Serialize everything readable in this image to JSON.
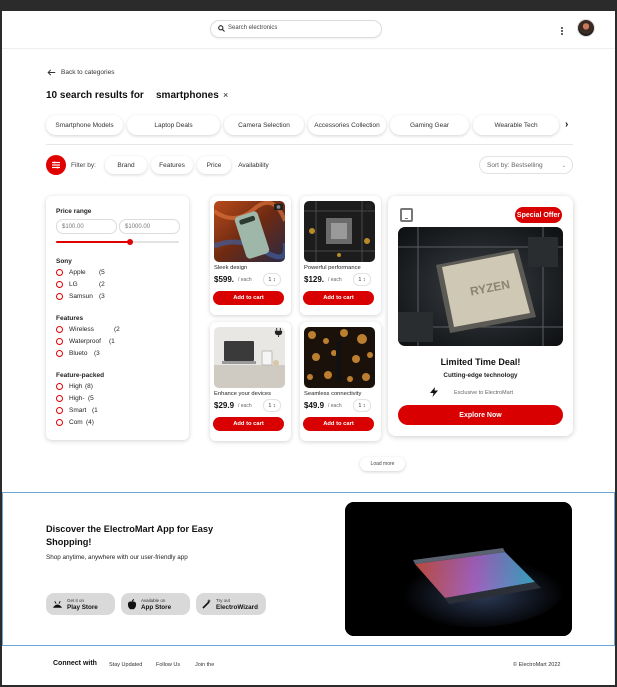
{
  "header": {
    "search_placeholder": "Search electronics",
    "avatar_icon": "user-avatar",
    "menu_icon": "kebab-menu-icon"
  },
  "nav": {
    "back_label": "Back to categories"
  },
  "results": {
    "heading": "10 search results for",
    "query": "smartphones",
    "clear_icon": "×"
  },
  "categories": [
    "Smartphone Models",
    "Laptop Deals",
    "Camera Selection",
    "Accessories Collection",
    "Gaming Gear",
    "Wearable Tech"
  ],
  "categories_next": "›",
  "filters": {
    "label": "Filter by:",
    "chips": [
      "Brand",
      "Features",
      "Price",
      "Availability"
    ],
    "sort": "Sort by: Bestselling",
    "sort_caret": "⌄"
  },
  "sidebar": {
    "price_range": {
      "title": "Price range",
      "min_placeholder": "$100.00",
      "max_placeholder": "$1000.00",
      "slider_level": 0.6
    },
    "groups": [
      {
        "title": "Sony",
        "options": [
          {
            "label": "Apple",
            "count": "(5"
          },
          {
            "label": "LG",
            "count": "(2"
          },
          {
            "label": "Samsun",
            "count": "(3"
          }
        ]
      },
      {
        "title": "Features",
        "options": [
          {
            "label": "Wireless",
            "count": "(2"
          },
          {
            "label": "Waterproof",
            "count": "(1"
          },
          {
            "label": "Blueto",
            "count": "(3"
          }
        ]
      },
      {
        "title": "Feature-packed",
        "options": [
          {
            "label": "High",
            "count": "(8)"
          },
          {
            "label": "High-",
            "count": "(5"
          },
          {
            "label": "Smart",
            "count": "(1"
          },
          {
            "label": "Com",
            "count": "(4)"
          }
        ]
      }
    ]
  },
  "products": [
    {
      "title": "Sleek design",
      "price": "$599.",
      "unit": "/ each",
      "qty": "1 ↕",
      "cta": "Add to cart"
    },
    {
      "title": "Powerful performance",
      "price": "$129.",
      "unit": "/ each",
      "qty": "1 ↕",
      "cta": "Add to cart"
    },
    {
      "title": "Enhance your devices",
      "price": "$29.9",
      "unit": "/ each",
      "qty": "1 ↕",
      "cta": "Add to cart"
    },
    {
      "title": "Seamless connectivity",
      "price": "$49.9",
      "unit": "/ each",
      "qty": "1 ↕",
      "cta": "Add to cart"
    }
  ],
  "promo": {
    "badge": "Special Offer",
    "title": "Limited Time Deal!",
    "subtitle": "Cutting-edge technology",
    "exclusive": "Exclusive to ElectroMart",
    "cta": "Explore Now",
    "chip_text": "RYZEN"
  },
  "load_more": "Load more",
  "app_promo": {
    "title": "Discover the ElectroMart App for Easy Shopping!",
    "subtitle": "Shop anytime, anywhere with our user-friendly app",
    "stores": [
      {
        "small": "Get it on",
        "big": "Play Store",
        "icon": "play-store-icon"
      },
      {
        "small": "Available on",
        "big": "App Store",
        "icon": "apple-icon"
      },
      {
        "small": "Try out",
        "big": "ElectroWizard",
        "icon": "magic-wand-icon"
      }
    ]
  },
  "footer": {
    "connect": "Connect with",
    "links": [
      "Stay Updated",
      "Follow Us",
      "Join the"
    ],
    "copyright": "© ElectroMart 2022"
  },
  "colors": {
    "accent": "#d80000",
    "focus_border": "#6aa6da"
  }
}
